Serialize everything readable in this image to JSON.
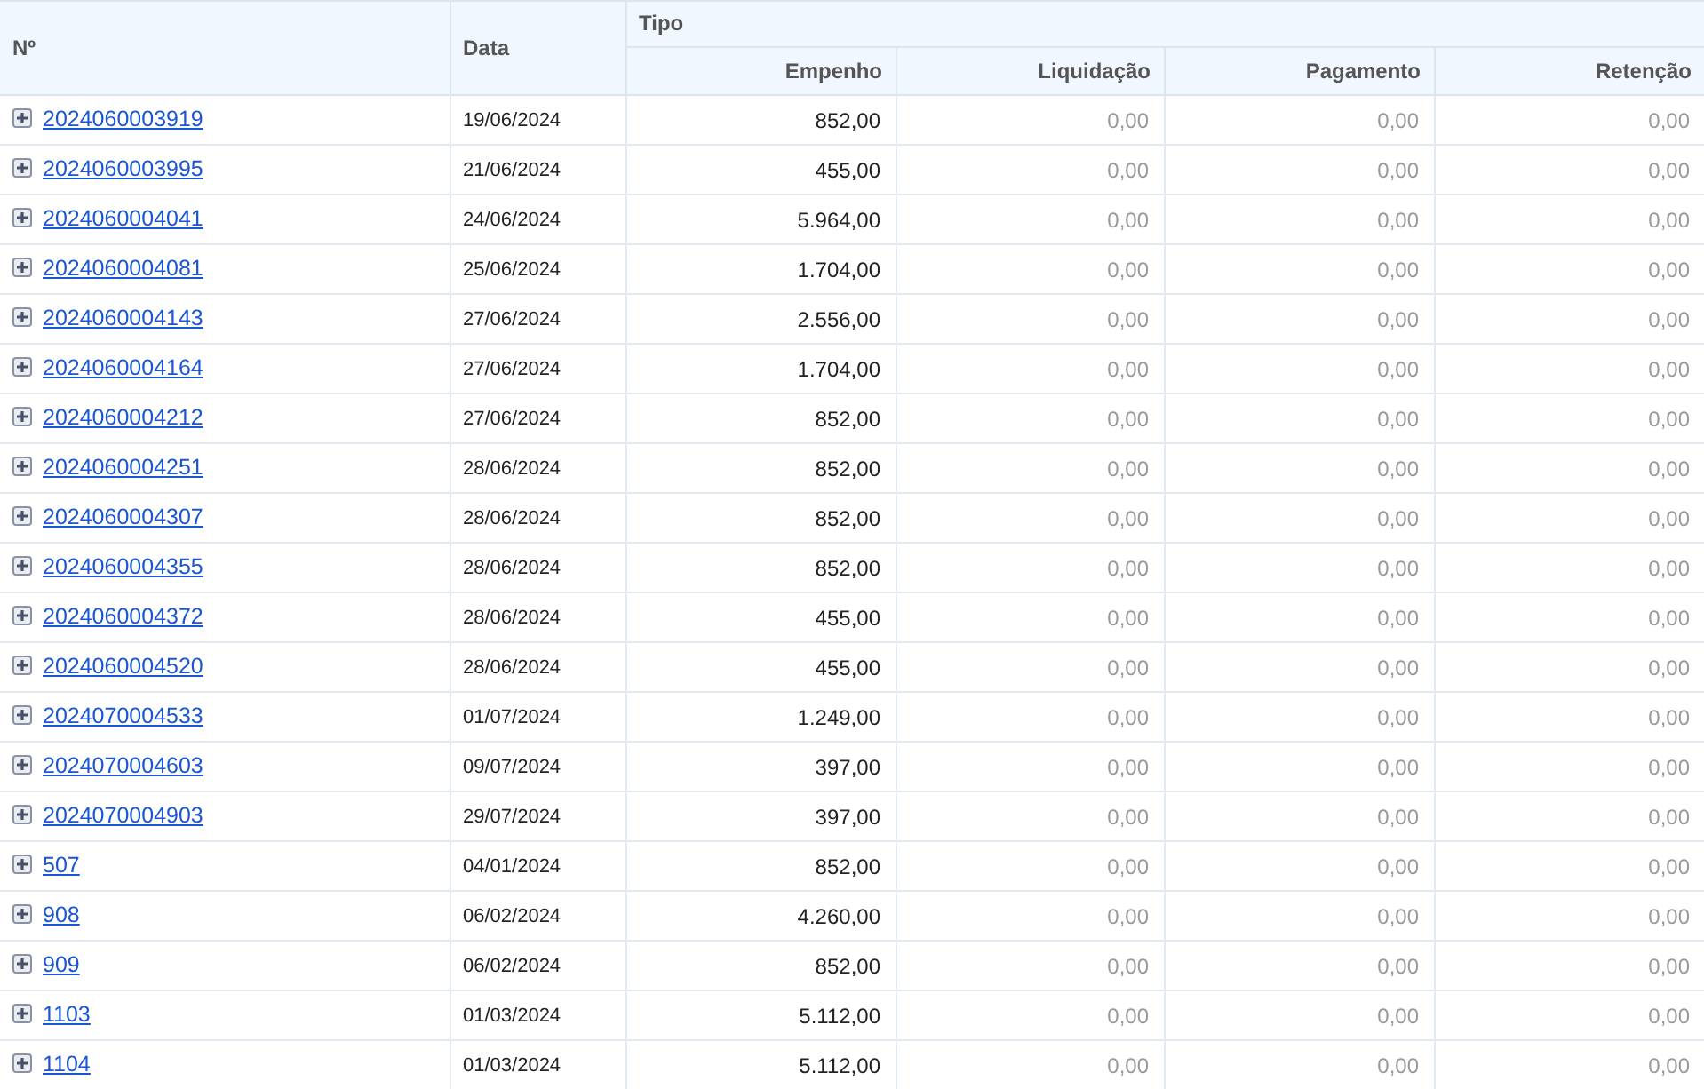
{
  "table": {
    "columns": [
      "Nº",
      "Data"
    ],
    "group": {
      "label": "Tipo",
      "columns": [
        "Empenho",
        "Liquidação",
        "Pagamento",
        "Retenção"
      ]
    },
    "rows": [
      {
        "number": "2024060003919",
        "date": "19/06/2024",
        "values": [
          "852,00",
          "0,00",
          "0,00",
          "0,00"
        ]
      },
      {
        "number": "2024060003995",
        "date": "21/06/2024",
        "values": [
          "455,00",
          "0,00",
          "0,00",
          "0,00"
        ]
      },
      {
        "number": "2024060004041",
        "date": "24/06/2024",
        "values": [
          "5.964,00",
          "0,00",
          "0,00",
          "0,00"
        ]
      },
      {
        "number": "2024060004081",
        "date": "25/06/2024",
        "values": [
          "1.704,00",
          "0,00",
          "0,00",
          "0,00"
        ]
      },
      {
        "number": "2024060004143",
        "date": "27/06/2024",
        "values": [
          "2.556,00",
          "0,00",
          "0,00",
          "0,00"
        ]
      },
      {
        "number": "2024060004164",
        "date": "27/06/2024",
        "values": [
          "1.704,00",
          "0,00",
          "0,00",
          "0,00"
        ]
      },
      {
        "number": "2024060004212",
        "date": "27/06/2024",
        "values": [
          "852,00",
          "0,00",
          "0,00",
          "0,00"
        ]
      },
      {
        "number": "2024060004251",
        "date": "28/06/2024",
        "values": [
          "852,00",
          "0,00",
          "0,00",
          "0,00"
        ]
      },
      {
        "number": "2024060004307",
        "date": "28/06/2024",
        "values": [
          "852,00",
          "0,00",
          "0,00",
          "0,00"
        ]
      },
      {
        "number": "2024060004355",
        "date": "28/06/2024",
        "values": [
          "852,00",
          "0,00",
          "0,00",
          "0,00"
        ]
      },
      {
        "number": "2024060004372",
        "date": "28/06/2024",
        "values": [
          "455,00",
          "0,00",
          "0,00",
          "0,00"
        ]
      },
      {
        "number": "2024060004520",
        "date": "28/06/2024",
        "values": [
          "455,00",
          "0,00",
          "0,00",
          "0,00"
        ]
      },
      {
        "number": "2024070004533",
        "date": "01/07/2024",
        "values": [
          "1.249,00",
          "0,00",
          "0,00",
          "0,00"
        ]
      },
      {
        "number": "2024070004603",
        "date": "09/07/2024",
        "values": [
          "397,00",
          "0,00",
          "0,00",
          "0,00"
        ]
      },
      {
        "number": "2024070004903",
        "date": "29/07/2024",
        "values": [
          "397,00",
          "0,00",
          "0,00",
          "0,00"
        ]
      },
      {
        "number": "507",
        "date": "04/01/2024",
        "values": [
          "852,00",
          "0,00",
          "0,00",
          "0,00"
        ]
      },
      {
        "number": "908",
        "date": "06/02/2024",
        "values": [
          "4.260,00",
          "0,00",
          "0,00",
          "0,00"
        ]
      },
      {
        "number": "909",
        "date": "06/02/2024",
        "values": [
          "852,00",
          "0,00",
          "0,00",
          "0,00"
        ]
      },
      {
        "number": "1103",
        "date": "01/03/2024",
        "values": [
          "5.112,00",
          "0,00",
          "0,00",
          "0,00"
        ]
      },
      {
        "number": "1104",
        "date": "01/03/2024",
        "values": [
          "5.112,00",
          "0,00",
          "0,00",
          "0,00"
        ]
      }
    ]
  }
}
